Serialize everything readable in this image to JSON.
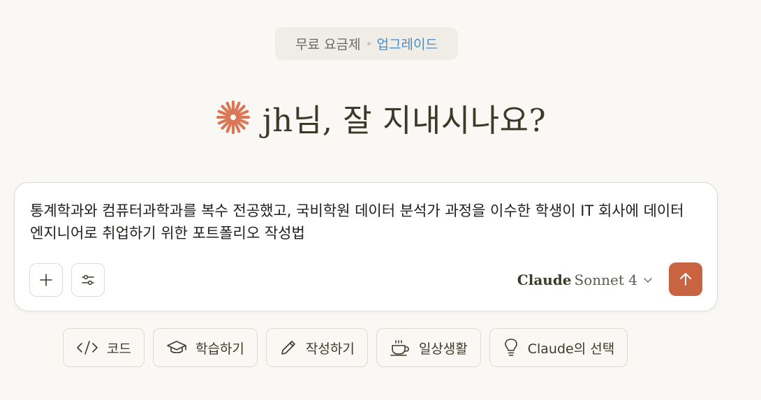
{
  "plan": {
    "label": "무료 요금제",
    "upgrade": "업그레이드",
    "accent_color": "#4a8ec9"
  },
  "greeting": {
    "text": "jh님, 잘 지내시나요?",
    "icon": "claude-spark-icon",
    "icon_color": "#d97757"
  },
  "composer": {
    "prompt": "통계학과와 컴퓨터과학과를 복수 전공했고, 국비학원 데이터 분석가 과정을 이수한 학생이 IT 회사에 데이터 엔지니어로 취업하기 위한 포트폴리오 작성법",
    "add_icon": "plus-icon",
    "tools_icon": "sliders-icon",
    "model": {
      "brand": "Claude",
      "name": "Sonnet 4"
    },
    "send_icon": "arrow-up-icon",
    "send_color": "#c96442"
  },
  "suggestions": [
    {
      "label": "코드",
      "icon": "code-icon"
    },
    {
      "label": "학습하기",
      "icon": "graduation-cap-icon"
    },
    {
      "label": "작성하기",
      "icon": "pencil-icon"
    },
    {
      "label": "일상생활",
      "icon": "coffee-cup-icon"
    },
    {
      "label": "Claude의 선택",
      "icon": "lightbulb-icon"
    }
  ]
}
